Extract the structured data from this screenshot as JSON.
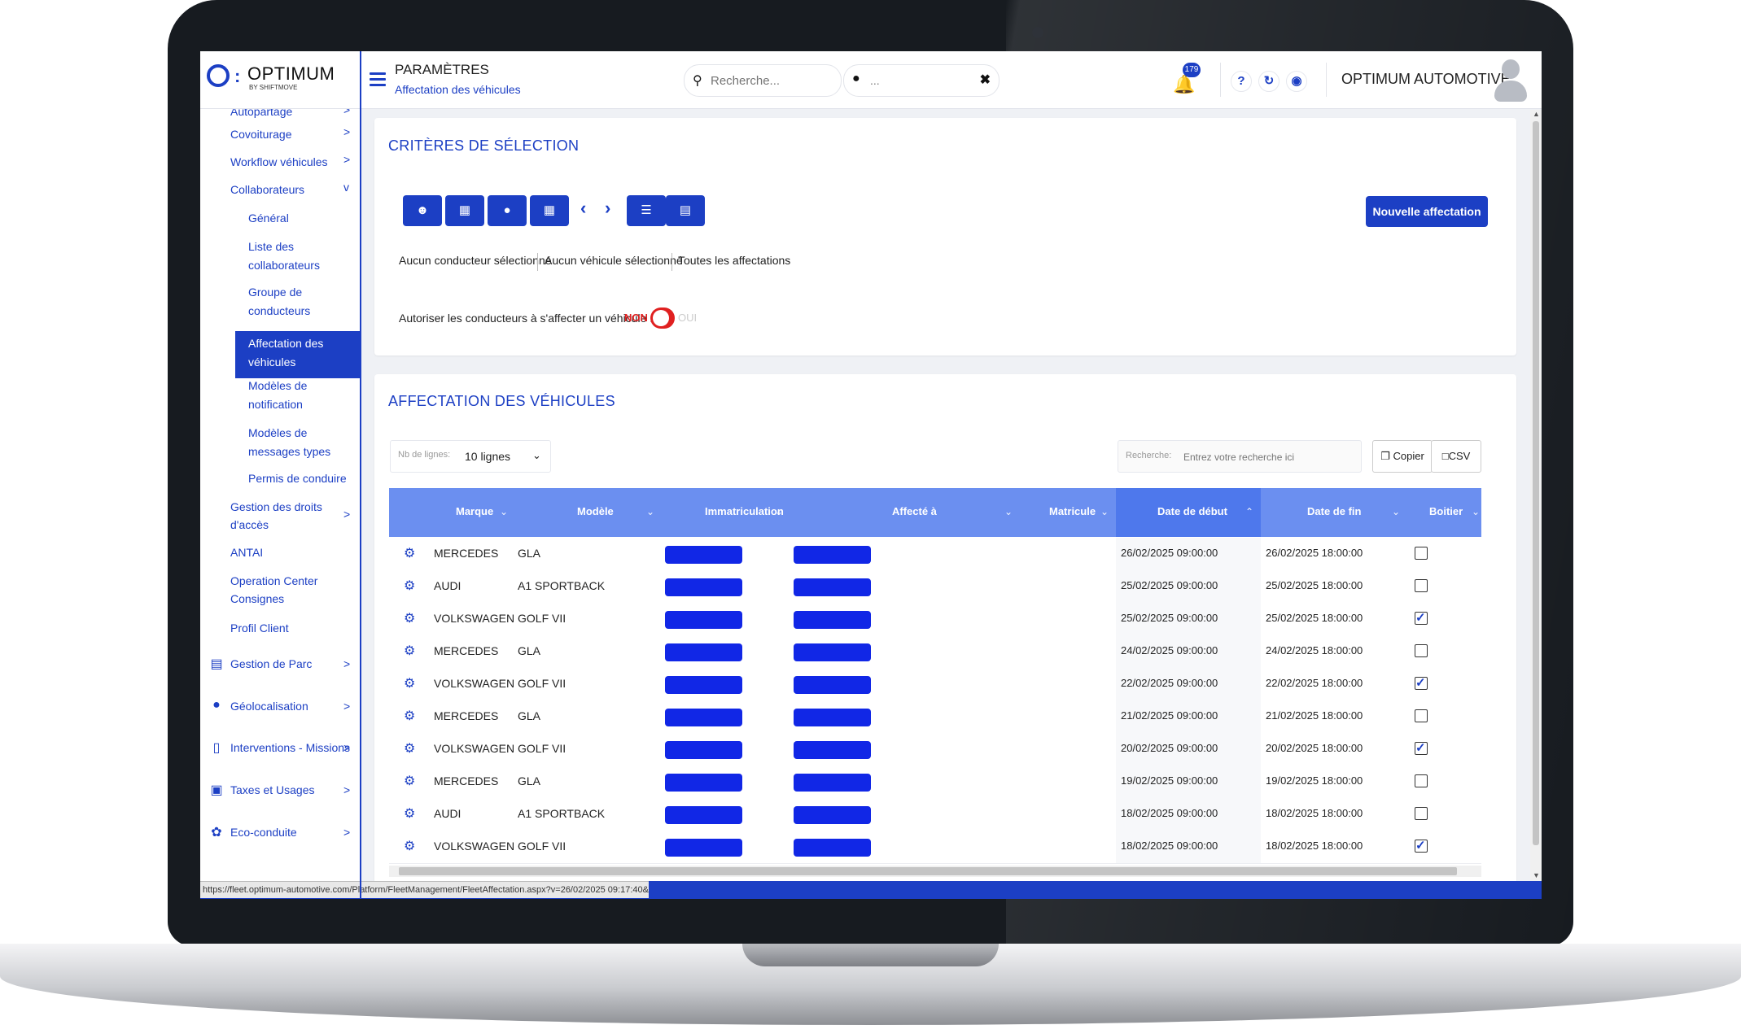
{
  "header": {
    "brand": "OPTIMUM",
    "brand_sub": "BY SHIFTMOVE",
    "page_title": "PARAMÈTRES",
    "page_subtitle": "Affectation des véhicules",
    "search_placeholder": "Recherche...",
    "location_placeholder": "...",
    "notification_count": "179",
    "company": "OPTIMUM AUTOMOTIVE",
    "icons": [
      "search-icon",
      "location-pin-icon",
      "close-icon",
      "bell-icon",
      "help-icon",
      "refresh-icon",
      "globe-icon",
      "user-avatar-icon"
    ]
  },
  "sidebar": {
    "items": [
      {
        "label": "Autopartage",
        "chevron": ">"
      },
      {
        "label": "Covoiturage",
        "chevron": ">"
      },
      {
        "label": "Workflow véhicules",
        "chevron": ">"
      },
      {
        "label": "Collaborateurs",
        "chevron": "v"
      }
    ],
    "subitems": [
      "Général",
      "Liste des collaborateurs",
      "Groupe de conducteurs"
    ],
    "active": "Affectation des véhicules",
    "subitems2": [
      "Modèles de notification",
      "Modèles de messages types",
      "Permis de conduire"
    ],
    "items2": [
      {
        "label": "Gestion des droits d'accès",
        "chevron": ">"
      },
      {
        "label": "ANTAI"
      },
      {
        "label": "Operation Center Consignes"
      },
      {
        "label": "Profil Client"
      }
    ],
    "main": [
      {
        "label": "Gestion de Parc",
        "icon": "car-icon"
      },
      {
        "label": "Géolocalisation",
        "icon": "location-icon"
      },
      {
        "label": "Interventions - Missions",
        "icon": "mobile-icon"
      },
      {
        "label": "Taxes et Usages",
        "icon": "briefcase-icon"
      },
      {
        "label": "Eco-conduite",
        "icon": "leaf-icon"
      }
    ]
  },
  "criteria": {
    "title": "CRITÈRES DE SÉLECTION",
    "new_button": "Nouvelle affectation",
    "filters": [
      "Aucun conducteur sélectionné",
      "Aucun véhicule sélectionné",
      "Toutes les affectations"
    ],
    "toggle_label": "Autoriser les conducteurs à s'affecter un véhicule :",
    "toggle_off": "NON",
    "toggle_on": "OUI"
  },
  "assignments": {
    "title": "AFFECTATION DES VÉHICULES",
    "rows_label": "Nb de lignes:",
    "rows_value": "10 lignes",
    "search_label": "Recherche:",
    "search_placeholder": "Entrez votre recherche ici",
    "copy_label": "Copier",
    "csv_label": "CSV",
    "columns": [
      "Marque",
      "Modèle",
      "Immatriculation",
      "Affecté à",
      "Matricule",
      "Date de début",
      "Date de fin",
      "Boitier"
    ],
    "rows": [
      {
        "marque": "MERCEDES",
        "modele": "GLA",
        "debut": "26/02/2025 09:00:00",
        "fin": "26/02/2025 18:00:00",
        "boitier": false
      },
      {
        "marque": "AUDI",
        "modele": "A1 SPORTBACK",
        "debut": "25/02/2025 09:00:00",
        "fin": "25/02/2025 18:00:00",
        "boitier": false
      },
      {
        "marque": "VOLKSWAGEN",
        "modele": "GOLF VII",
        "debut": "25/02/2025 09:00:00",
        "fin": "25/02/2025 18:00:00",
        "boitier": true
      },
      {
        "marque": "MERCEDES",
        "modele": "GLA",
        "debut": "24/02/2025 09:00:00",
        "fin": "24/02/2025 18:00:00",
        "boitier": false
      },
      {
        "marque": "VOLKSWAGEN",
        "modele": "GOLF VII",
        "debut": "22/02/2025 09:00:00",
        "fin": "22/02/2025 18:00:00",
        "boitier": true
      },
      {
        "marque": "MERCEDES",
        "modele": "GLA",
        "debut": "21/02/2025 09:00:00",
        "fin": "21/02/2025 18:00:00",
        "boitier": false
      },
      {
        "marque": "VOLKSWAGEN",
        "modele": "GOLF VII",
        "debut": "20/02/2025 09:00:00",
        "fin": "20/02/2025 18:00:00",
        "boitier": true
      },
      {
        "marque": "MERCEDES",
        "modele": "GLA",
        "debut": "19/02/2025 09:00:00",
        "fin": "19/02/2025 18:00:00",
        "boitier": false
      },
      {
        "marque": "AUDI",
        "modele": "A1 SPORTBACK",
        "debut": "18/02/2025 09:00:00",
        "fin": "18/02/2025 18:00:00",
        "boitier": false
      },
      {
        "marque": "VOLKSWAGEN",
        "modele": "GOLF VII",
        "debut": "18/02/2025 09:00:00",
        "fin": "18/02/2025 18:00:00",
        "boitier": true
      }
    ]
  },
  "status_url": "https://fleet.optimum-automotive.com/Platform/FleetManagement/FleetAffectation.aspx?v=26/02/2025 09:17:40&ca...",
  "colors": {
    "accent": "#1c3fc4",
    "table_header": "#6b8ff0",
    "redaction": "#1127e6",
    "toggle_off": "#e02020"
  }
}
